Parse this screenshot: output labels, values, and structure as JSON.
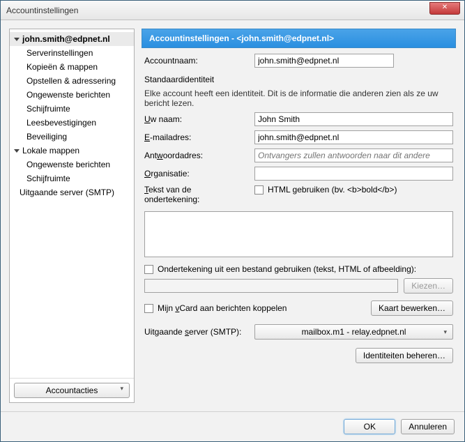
{
  "window": {
    "title": "Accountinstellingen"
  },
  "sidebar": {
    "root_label": "john.smith@edpnet.nl",
    "items": [
      "Serverinstellingen",
      "Kopieën & mappen",
      "Opstellen & adressering",
      "Ongewenste berichten",
      "Schijfruimte",
      "Leesbevestigingen",
      "Beveiliging"
    ],
    "local_label": "Lokale mappen",
    "local_items": [
      "Ongewenste berichten",
      "Schijfruimte"
    ],
    "smtp_label": "Uitgaande server (SMTP)",
    "account_actions": "Accountacties"
  },
  "panel": {
    "header": "Accountinstellingen - <john.smith@edpnet.nl>",
    "account_name_label": "Accountnaam:",
    "account_name_value": "john.smith@edpnet.nl",
    "default_identity_title": "Standaardidentiteit",
    "default_identity_desc": "Elke account heeft een identiteit. Dit is de informatie die anderen zien als ze uw bericht lezen.",
    "your_name_label": "Uw naam:",
    "your_name_value": "John Smith",
    "email_label": "E-mailadres:",
    "email_value": "john.smith@edpnet.nl",
    "reply_label": "Antwoordadres:",
    "reply_placeholder": "Ontvangers zullen antwoorden naar dit andere",
    "org_label": "Organisatie:",
    "sig_text_label": "Tekst van de ondertekening:",
    "html_checkbox_label": "HTML gebruiken (bv. <b>bold</b>)",
    "sig_file_label": "Ondertekening uit een bestand gebruiken (tekst, HTML of afbeelding):",
    "choose_btn": "Kiezen…",
    "vcard_label": "Mijn vCard aan berichten koppelen",
    "edit_card_btn": "Kaart bewerken…",
    "smtp_label": "Uitgaande server (SMTP):",
    "smtp_selected": "mailbox.m1 - relay.edpnet.nl",
    "identities_btn": "Identiteiten beheren…"
  },
  "buttons": {
    "ok": "OK",
    "cancel": "Annuleren"
  }
}
